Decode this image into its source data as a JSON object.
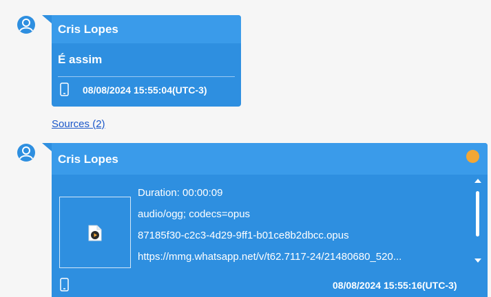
{
  "messages": [
    {
      "sender": "Cris Lopes",
      "text": "É assim",
      "timestamp": "08/08/2024 15:55:04(UTC-3)",
      "device_icon": "phone-icon",
      "avatar_icon": "user-avatar-icon"
    },
    {
      "sender": "Cris Lopes",
      "status_color": "#f3a735",
      "attachment": {
        "icon": "audio-file-icon",
        "duration": "Duration: 00:00:09",
        "mime": "audio/ogg; codecs=opus",
        "filename": "87185f30-c2c3-4d29-9ff1-b01ce8b2dbcc.opus",
        "url": "https://mmg.whatsapp.net/v/t62.7117-24/21480680_520..."
      },
      "timestamp": "08/08/2024 15:55:16(UTC-3)",
      "device_icon": "phone-icon",
      "avatar_icon": "user-avatar-icon"
    }
  ],
  "sources_link": "Sources (2)",
  "colors": {
    "bubble": "#2e8fe0",
    "header": "#3a9bea",
    "avatar": "#2e8fe0",
    "link": "#1a57c9",
    "status": "#f3a735"
  }
}
